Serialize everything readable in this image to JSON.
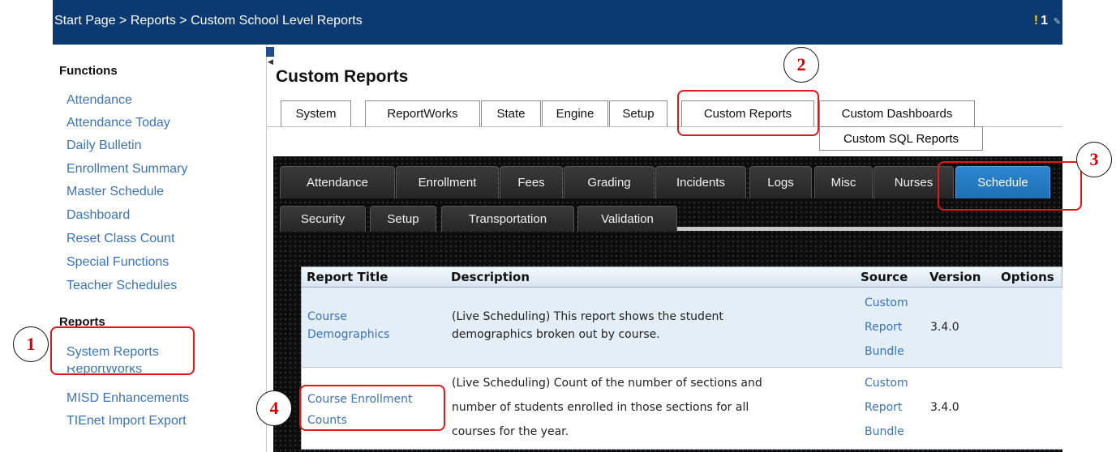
{
  "header": {
    "breadcrumb": "Start Page > Reports > Custom School Level Reports",
    "alert_count": "1"
  },
  "sidebar": {
    "functions_heading": "Functions",
    "functions": [
      "Attendance",
      "Attendance Today",
      "Daily Bulletin",
      "Enrollment Summary",
      "Master Schedule",
      "Dashboard",
      "Reset Class Count",
      "Special Functions",
      "Teacher Schedules"
    ],
    "reports_heading": "Reports",
    "reports": [
      "System Reports",
      "ReportWorks",
      "MISD Enhancements",
      "TIEnet Import Export"
    ]
  },
  "main": {
    "title": "Custom Reports",
    "tabs": [
      "System",
      "ReportWorks",
      "State",
      "Engine",
      "Setup",
      "Custom Reports",
      "Custom Dashboards",
      "Custom SQL Reports"
    ],
    "category_tabs": [
      "Attendance",
      "Enrollment",
      "Fees",
      "Grading",
      "Incidents",
      "Logs",
      "Misc",
      "Nurses",
      "Schedule",
      "Security",
      "Setup",
      "Transportation",
      "Validation"
    ],
    "selected_category": "Schedule"
  },
  "table": {
    "headers": [
      "Report Title",
      "Description",
      "Source",
      "Version",
      "Options"
    ],
    "rows": [
      {
        "title": [
          "Course",
          "Demographics"
        ],
        "description": [
          "(Live Scheduling) This report shows the student",
          "demographics broken out by course."
        ],
        "source": [
          "Custom",
          "Report",
          "Bundle"
        ],
        "version": "3.4.0"
      },
      {
        "title": [
          "Course Enrollment",
          "Counts"
        ],
        "description": [
          "(Live Scheduling) Count of the number of sections and",
          "number of students enrolled in those sections for all",
          "courses for the year."
        ],
        "source": [
          "Custom",
          "Report",
          "Bundle"
        ],
        "version": "3.4.0"
      }
    ]
  },
  "annotations": [
    "1",
    "2",
    "3",
    "4"
  ],
  "colors": {
    "header_bg": "#0b3a72",
    "link": "#3b73b9",
    "active_tab": "#1f6fb4",
    "callout_red": "#e01818"
  }
}
